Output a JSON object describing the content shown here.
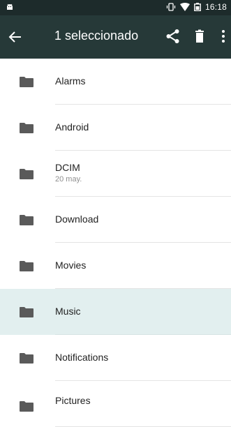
{
  "status_bar": {
    "time": "16:18"
  },
  "action_bar": {
    "title": "1 seleccionado"
  },
  "colors": {
    "status_bar": "#1d2b2b",
    "action_bar": "#263938",
    "selected_row": "#e2efef",
    "folder_icon": "#5a5a5a"
  },
  "folders": [
    {
      "name": "Alarms",
      "date": "",
      "selected": false
    },
    {
      "name": "Android",
      "date": "",
      "selected": false
    },
    {
      "name": "DCIM",
      "date": "20 may.",
      "selected": false
    },
    {
      "name": "Download",
      "date": "",
      "selected": false
    },
    {
      "name": "Movies",
      "date": "",
      "selected": false
    },
    {
      "name": "Music",
      "date": "",
      "selected": true
    },
    {
      "name": "Notifications",
      "date": "",
      "selected": false
    },
    {
      "name": "Pictures",
      "date": "",
      "selected": false
    }
  ]
}
